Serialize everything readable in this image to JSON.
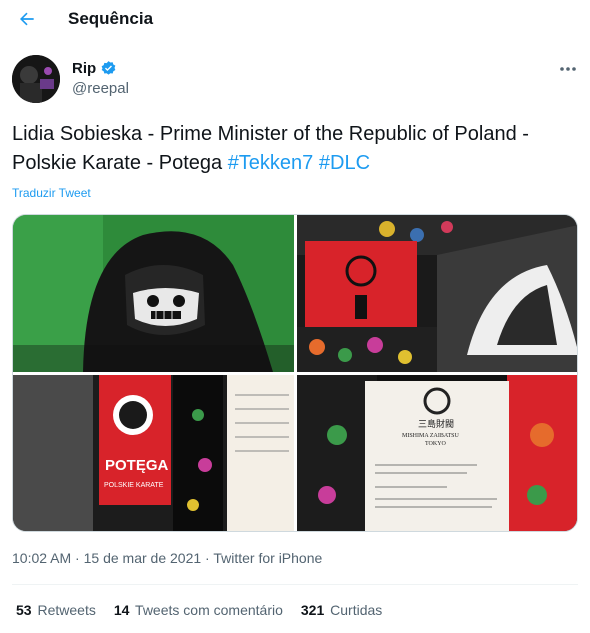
{
  "header": {
    "title": "Sequência"
  },
  "author": {
    "name": "Rip",
    "handle": "@reepal"
  },
  "tweet": {
    "text": "Lidia Sobieska - Prime Minister of the Republic of Poland - Polskie Karate - Potega ",
    "hashtags": [
      "#Tekken7",
      "#DLC"
    ],
    "translate_label": "Traduzir Tweet"
  },
  "photos": {
    "p3_brand": "POTĘGA",
    "p3_sub": "POLSKIE KARATE",
    "p4_title": "三島財閥",
    "p4_sub": "MISHIMA ZAIBATSU",
    "p4_city": "TOKYO"
  },
  "meta": {
    "time": "10:02 AM",
    "sep": " · ",
    "date": "15 de mar de 2021",
    "source": "Twitter for iPhone"
  },
  "stats": [
    {
      "count": "53",
      "label": "Retweets"
    },
    {
      "count": "14",
      "label": "Tweets com comentário"
    },
    {
      "count": "321",
      "label": "Curtidas"
    }
  ],
  "colors": {
    "accent": "#1d9bf0",
    "muted": "#536471",
    "text": "#0f1419"
  }
}
